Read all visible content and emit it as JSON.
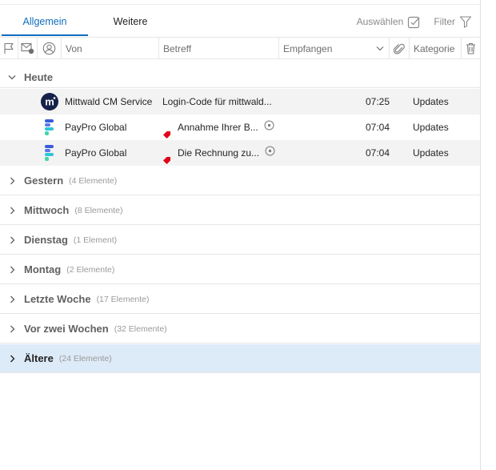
{
  "tabs": {
    "allgemein": "Allgemein",
    "weitere": "Weitere"
  },
  "toolbar": {
    "select_label": "Auswählen",
    "filter_label": "Filter"
  },
  "columns": {
    "von": "Von",
    "betreff": "Betreff",
    "empfangen": "Empfangen",
    "kategorie": "Kategorie"
  },
  "today": {
    "label": "Heute",
    "messages": [
      {
        "from": "Mittwald CM Service",
        "subject": "Login-Code für mittwald...",
        "time": "07:25",
        "category": "Updates",
        "avatar_icon": "mittwald-logo-icon",
        "tagged": false
      },
      {
        "from": "PayPro Global",
        "subject": "Annahme Ihrer B...",
        "time": "07:04",
        "category": "Updates",
        "avatar_icon": "paypro-logo-icon",
        "tagged": true
      },
      {
        "from": "PayPro Global",
        "subject": "Die Rechnung zu...",
        "time": "07:04",
        "category": "Updates",
        "avatar_icon": "paypro-logo-icon",
        "tagged": true
      }
    ]
  },
  "groups": [
    {
      "name": "Gestern",
      "count": "(4 Elemente)"
    },
    {
      "name": "Mittwoch",
      "count": "(8 Elemente)"
    },
    {
      "name": "Dienstag",
      "count": "(1 Element)"
    },
    {
      "name": "Montag",
      "count": "(2 Elemente)"
    },
    {
      "name": "Letzte Woche",
      "count": "(17 Elemente)"
    },
    {
      "name": "Vor zwei Wochen",
      "count": "(32 Elemente)"
    },
    {
      "name": "Ältere",
      "count": "(24 Elemente)"
    }
  ],
  "colors": {
    "accent": "#0f6cbd",
    "selected_bg": "#ddeaf7",
    "tag_red": "#e3001b"
  }
}
